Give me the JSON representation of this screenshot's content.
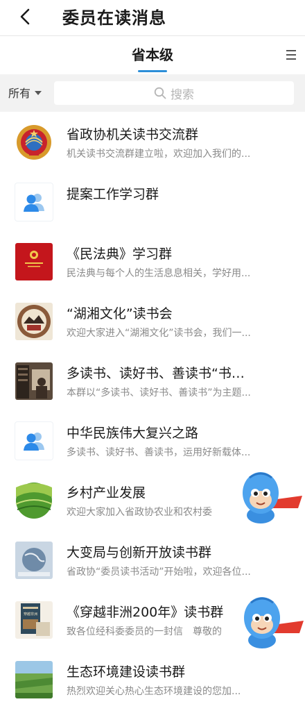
{
  "header": {
    "title": "委员在读消息",
    "back_icon": "chevron-left-icon"
  },
  "tabs": {
    "active": "省本级",
    "menu_icon": "hamburger-menu-icon",
    "accent": "#2c8ed8"
  },
  "search": {
    "filter_label": "所有",
    "placeholder": "搜索"
  },
  "groups": [
    {
      "title": "省政协机关读书交流群",
      "subtitle": "机关读书交流群建立啦，欢迎加入我们的..."
    },
    {
      "title": "提案工作学习群",
      "subtitle": ""
    },
    {
      "title": "《民法典》学习群",
      "subtitle": "民法典与每个人的生活息息相关，学好用..."
    },
    {
      "title": "“湖湘文化”读书会",
      "subtitle": "欢迎大家进入“湖湘文化”读书会，我们一..."
    },
    {
      "title": "多读书、读好书、善读书“书…",
      "subtitle": "本群以“多读书、读好书、善读书”为主题..."
    },
    {
      "title": "中华民族伟大复兴之路",
      "subtitle": "多读书、读好书、善读书，运用好新载体..."
    },
    {
      "title": "乡村产业发展",
      "subtitle": "欢迎大家加入省政协农业和农村委"
    },
    {
      "title": "大变局与创新开放读书群",
      "subtitle": "省政协“委员读书活动”开始啦，欢迎各位..."
    },
    {
      "title": "《穿越非洲200年》读书群",
      "subtitle": "致各位经科委委员的一封信　尊敬的"
    },
    {
      "title": "生态环境建设读书群",
      "subtitle": "热烈欢迎关心热心生态环境建设的您加..."
    }
  ],
  "book_cover_text": "穿越非洲两百年"
}
